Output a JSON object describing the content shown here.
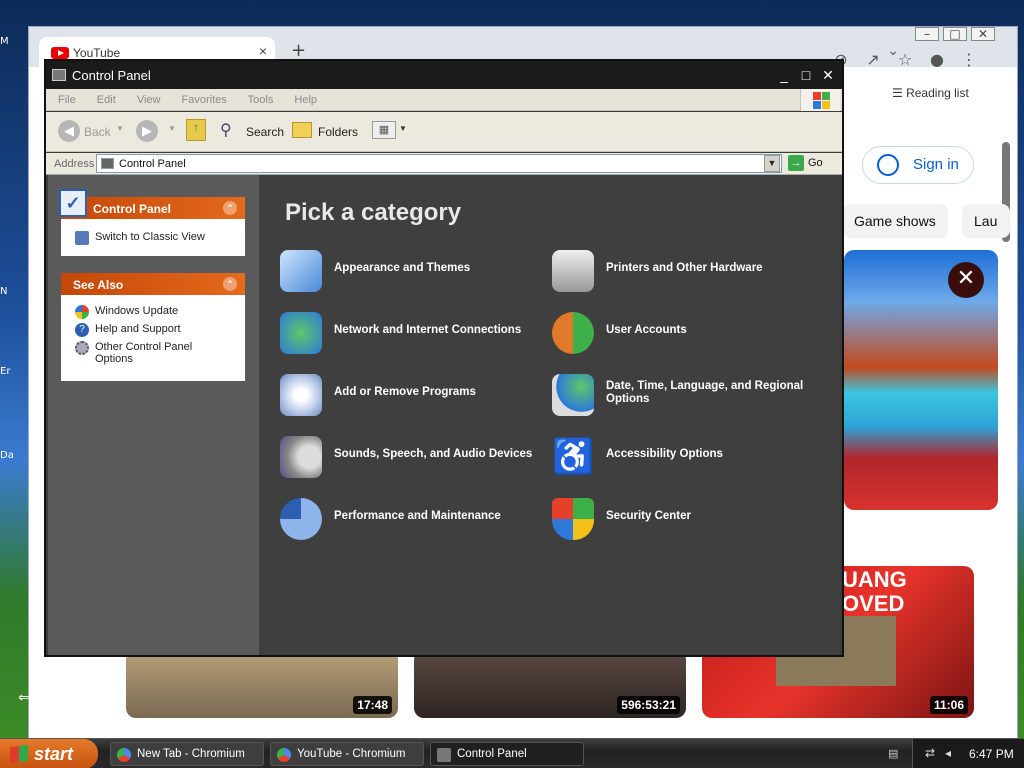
{
  "browser": {
    "tab_title": "YouTube",
    "new_tab": "+",
    "close_tab": "×",
    "reading_list": "Reading list",
    "sign_in": "Sign in",
    "chips": [
      "Game shows",
      "Lau"
    ],
    "video_durations": [
      "17:48",
      "596:53:21",
      "11:06"
    ],
    "thumb_overlay_text": [
      "UANG",
      "OVED"
    ]
  },
  "window": {
    "title": "Control Panel",
    "menu": [
      "File",
      "Edit",
      "View",
      "Favorites",
      "Tools",
      "Help"
    ],
    "toolbar": {
      "back": "Back",
      "search": "Search",
      "folders": "Folders"
    },
    "address_label": "Address",
    "address_value": "Control Panel",
    "go_label": "Go"
  },
  "sidebar": {
    "control_panel_header": "Control Panel",
    "switch_classic": "Switch to Classic View",
    "see_also_header": "See Also",
    "see_also_items": [
      "Windows Update",
      "Help and Support",
      "Other Control Panel Options"
    ]
  },
  "main": {
    "heading": "Pick a category",
    "categories": [
      "Appearance and Themes",
      "Printers and Other Hardware",
      "Network and Internet Connections",
      "User Accounts",
      "Add or Remove Programs",
      "Date, Time, Language, and Regional Options",
      "Sounds, Speech, and Audio Devices",
      "Accessibility Options",
      "Performance and Maintenance",
      "Security Center"
    ]
  },
  "taskbar": {
    "start": "start",
    "tasks": [
      "New Tab - Chromium",
      "YouTube - Chromium",
      "Control Panel"
    ],
    "clock": "6:47 PM"
  },
  "colors": {
    "panel_header": "#d5580f",
    "accent_link": "#065fd4",
    "window_bg": "#3f3f3f"
  }
}
